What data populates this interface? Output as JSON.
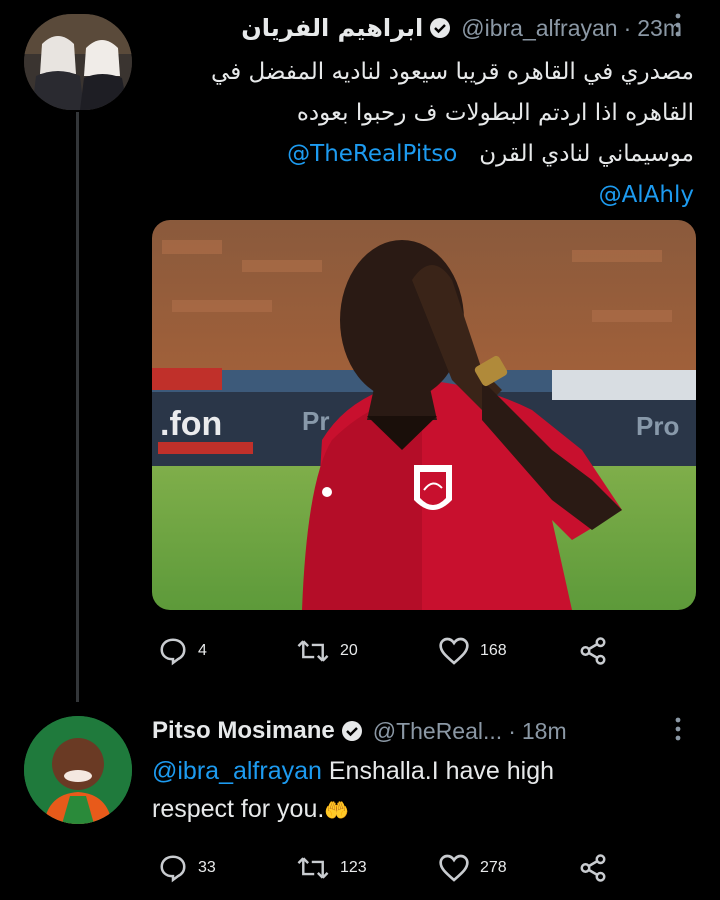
{
  "tweet1": {
    "display_name": "ابراهيم الفريان",
    "handle": "@ibra_alfrayan",
    "separator": "·",
    "time": "23m",
    "text_line1": "مصدري  في القاهره قريبا سيعود لناديه المفضل في",
    "text_line2": "القاهره اذا اردتم البطولات ف رحبوا بعوده",
    "text_line3": "موسيماني لنادي القرن",
    "mention1": "@TheRealPitso",
    "mention2": "@AlAhly",
    "replies": "4",
    "retweets": "20",
    "likes": "168"
  },
  "tweet2": {
    "display_name": "Pitso Mosimane",
    "handle": "@TheReal...",
    "separator": "·",
    "time": "18m",
    "mention": "@ibra_alfrayan",
    "text_part1": " Enshalla.I have high",
    "text_part2": "respect for you.",
    "emoji": "🤲",
    "replies": "33",
    "retweets": "123",
    "likes": "278"
  },
  "colors": {
    "background": "#000000",
    "link": "#1d9bf0",
    "muted": "#8b98a5",
    "verified": "#e7e9ea"
  },
  "icons": [
    "verified-badge-icon",
    "more-icon",
    "reply-icon",
    "retweet-icon",
    "like-icon",
    "share-icon"
  ]
}
